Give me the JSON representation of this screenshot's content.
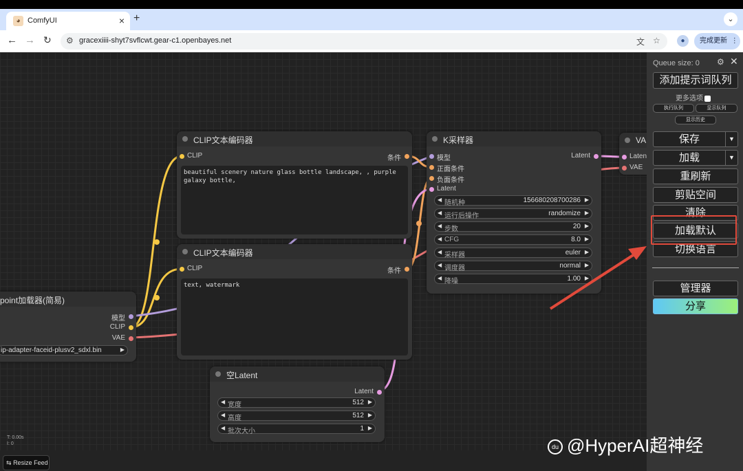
{
  "browser": {
    "tab_title": "ComfyUI",
    "url": "gracexiiii-shyt7svflcwt.gear-c1.openbayes.net",
    "update_label": "完成更新"
  },
  "nodes": {
    "clip_top": {
      "title": "CLIP文本编码器",
      "input": "CLIP",
      "output": "条件",
      "text": "beautiful scenery nature glass bottle landscape, , purple galaxy bottle,"
    },
    "clip_bottom": {
      "title": "CLIP文本编码器",
      "input": "CLIP",
      "output": "条件",
      "text": "text, watermark"
    },
    "ksampler": {
      "title": "K采样器",
      "inputs": [
        "模型",
        "正面条件",
        "负面条件",
        "Latent"
      ],
      "output": "Latent",
      "widgets": [
        {
          "label": "随机种",
          "value": "156680208700286"
        },
        {
          "label": "运行后操作",
          "value": "randomize"
        },
        {
          "label": "步数",
          "value": "20"
        },
        {
          "label": "CFG",
          "value": "8.0"
        },
        {
          "label": "采样器",
          "value": "euler"
        },
        {
          "label": "调度器",
          "value": "normal"
        },
        {
          "label": "降噪",
          "value": "1.00"
        }
      ]
    },
    "vae": {
      "title": "VAE",
      "inputs": [
        "Latent",
        "VAE"
      ]
    },
    "checkpoint": {
      "title": "point加载器(简易)",
      "outputs": [
        "模型",
        "CLIP",
        "VAE"
      ],
      "widget_value": "ip-adapter-faceid-plusv2_sdxl.bin"
    },
    "empty_latent": {
      "title": "空Latent",
      "output": "Latent",
      "widgets": [
        {
          "label": "宽度",
          "value": "512"
        },
        {
          "label": "高度",
          "value": "512"
        },
        {
          "label": "批次大小",
          "value": "1"
        }
      ]
    }
  },
  "stats": {
    "line1": "T: 0.00s",
    "line2": "I: 0"
  },
  "resize_feed": "Resize Feed",
  "menu": {
    "queue_size": "Queue size: 0",
    "queue_prompt": "添加提示词队列",
    "more_options": "更多选项",
    "view_queue": "执行队列",
    "view_queue2": "显示队列",
    "view_history": "显示历史",
    "save": "保存",
    "load": "加载",
    "refresh": "重刷新",
    "clipspace": "剪贴空间",
    "clear": "清除",
    "load_default": "加载默认",
    "switch_locale": "切换语言",
    "manager": "管理器",
    "share": "分享"
  },
  "watermark": "@HyperAI超神经",
  "colors": {
    "clip_wire": "#f5c844",
    "model_wire": "#b39ddb",
    "vae_wire": "#e57373",
    "latent_wire": "#e69be0",
    "cond_wire": "#f1a35c",
    "annotation": "#e24a3b",
    "share_gradient_start": "#5fc8f5",
    "share_gradient_end": "#9cf07a"
  }
}
